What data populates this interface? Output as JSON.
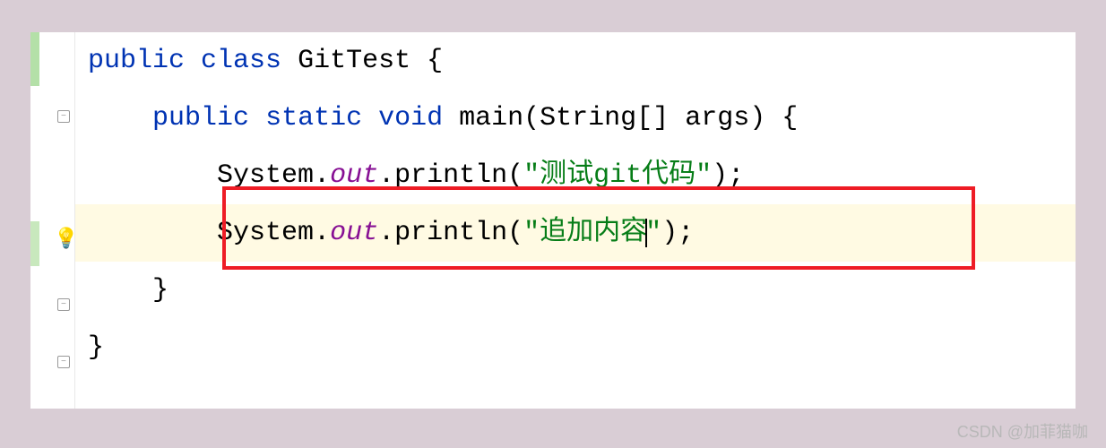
{
  "code": {
    "line1": {
      "kw_public": "public",
      "kw_class": "class",
      "class_name": "GitTest",
      "brace": "{"
    },
    "line2": {
      "kw_public": "public",
      "kw_static": "static",
      "kw_void": "void",
      "method": "main",
      "param_type": "String",
      "param_name": "args",
      "brace": "{"
    },
    "line3": {
      "obj": "System",
      "out": "out",
      "method": "println",
      "string": "\"测试git代码\"",
      "semi": ";"
    },
    "line4": {
      "obj": "System",
      "out": "out",
      "method": "println",
      "string_open": "\"追加内容",
      "string_close": "\"",
      "close_paren": ")",
      "semi": ";"
    },
    "line5": {
      "brace": "}"
    },
    "line6": {
      "brace": "}"
    }
  },
  "watermark": "CSDN @加菲猫咖"
}
